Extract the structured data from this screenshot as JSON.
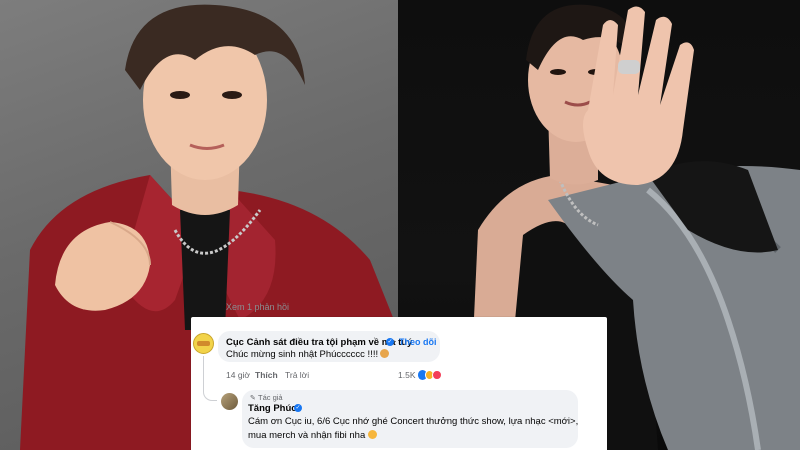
{
  "post": {
    "prev_reply_hint": "Xem 1 phản hồi"
  },
  "comment": {
    "author": "Cục Cảnh sát điều tra tội phạm về ma tuý",
    "follow_label": "Theo dõi",
    "separator": "·",
    "text": "Chúc mừng sinh nhật Phúcccccc !!!!",
    "time": "14 giờ",
    "like_label": "Thích",
    "reply_label": "Trả lời",
    "reaction_count": "1.5K"
  },
  "reply": {
    "author_badge": "Tác giả",
    "author": "Tăng Phúc",
    "text_line1": "Cám ơn Cục iu, 6/6 Cục nhớ ghé Concert thưởng thức show, lựa nhạc <mới>,",
    "text_line2": "mua merch và nhận fibi nha"
  },
  "icons": {
    "verified": "verified-badge-icon",
    "clover": "four-leaf-clover-emoji",
    "hug": "hugging-face-emoji",
    "pencil": "pencil-icon",
    "reaction_like": "like-reaction-icon",
    "reaction_haha": "haha-reaction-icon",
    "reaction_love": "love-reaction-icon"
  },
  "colors": {
    "link_blue": "#1877f2",
    "bubble_bg": "#f0f2f5",
    "muted_text": "#65676b"
  }
}
